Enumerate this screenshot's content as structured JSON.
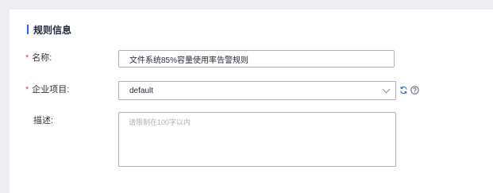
{
  "section": {
    "title": "规则信息"
  },
  "form": {
    "name": {
      "required_mark": "*",
      "label": "名称:",
      "value": "文件系统85%容量使用率告警规则"
    },
    "project": {
      "required_mark": "*",
      "label": "企业项目:",
      "value": "default"
    },
    "description": {
      "label": "描述:",
      "placeholder": "请限制在100字以内",
      "value": ""
    }
  },
  "icons": {
    "refresh": "refresh-icon",
    "help": "help-icon",
    "dropdown": "chevron-down-icon"
  },
  "colors": {
    "accent": "#2468f2",
    "required": "#e5484d",
    "page_bg": "#eceef2"
  }
}
